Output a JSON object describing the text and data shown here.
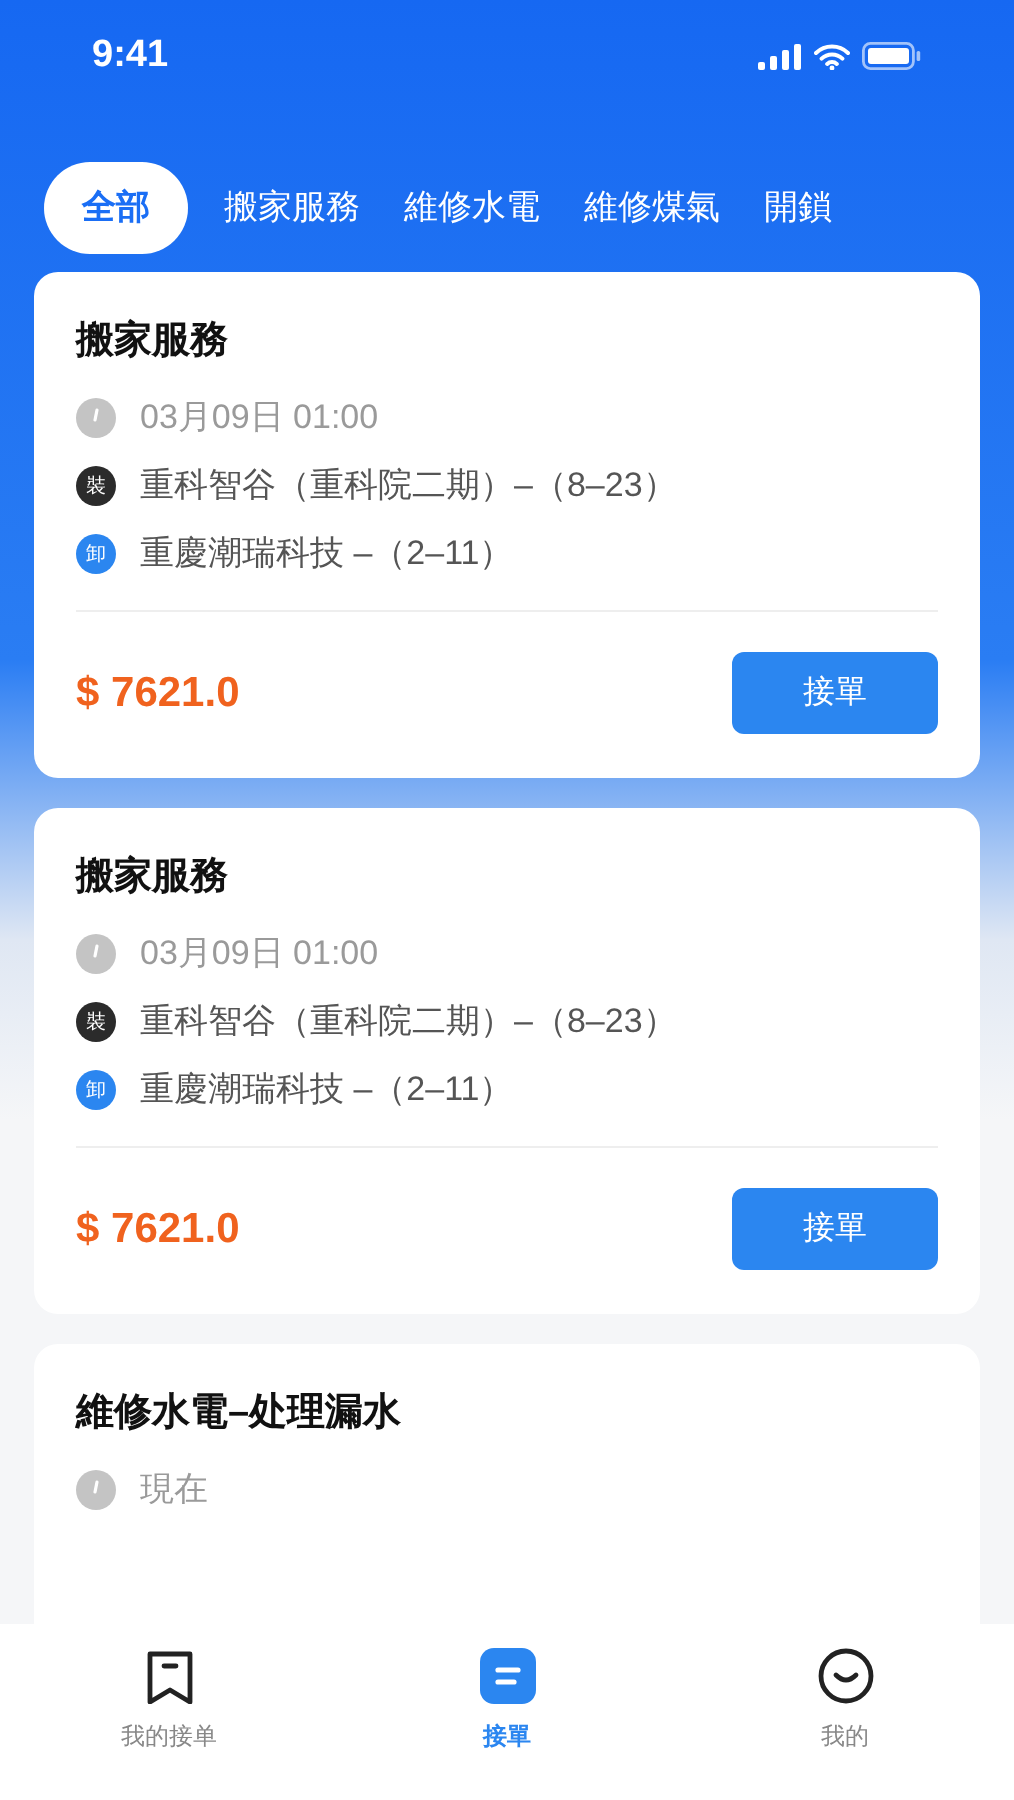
{
  "status_bar": {
    "time": "9:41"
  },
  "tabs": [
    {
      "label": "全部",
      "selected": true
    },
    {
      "label": "搬家服務",
      "selected": false
    },
    {
      "label": "維修水電",
      "selected": false
    },
    {
      "label": "維修煤氣",
      "selected": false
    },
    {
      "label": "開鎖",
      "selected": false
    }
  ],
  "orders": [
    {
      "title": "搬家服務",
      "time": "03月09日 01:00",
      "stops": [
        {
          "kind": "load",
          "badge": "裝",
          "address": "重科智谷（重科院二期）–（8–23）"
        },
        {
          "kind": "unload",
          "badge": "卸",
          "address": "重慶潮瑞科技 –（2–11）"
        }
      ],
      "price": "$ 7621.0",
      "action": "接單"
    },
    {
      "title": "搬家服務",
      "time": "03月09日 01:00",
      "stops": [
        {
          "kind": "load",
          "badge": "裝",
          "address": "重科智谷（重科院二期）–（8–23）"
        },
        {
          "kind": "unload",
          "badge": "卸",
          "address": "重慶潮瑞科技 –（2–11）"
        }
      ],
      "price": "$ 7621.0",
      "action": "接單"
    },
    {
      "title": "維修水電–处理漏水",
      "time": "現在"
    }
  ],
  "nav": [
    {
      "kind": "bookmark",
      "label": "我的接单",
      "selected": false
    },
    {
      "kind": "orders",
      "label": "接單",
      "selected": true
    },
    {
      "kind": "smile",
      "label": "我的",
      "selected": false
    }
  ]
}
